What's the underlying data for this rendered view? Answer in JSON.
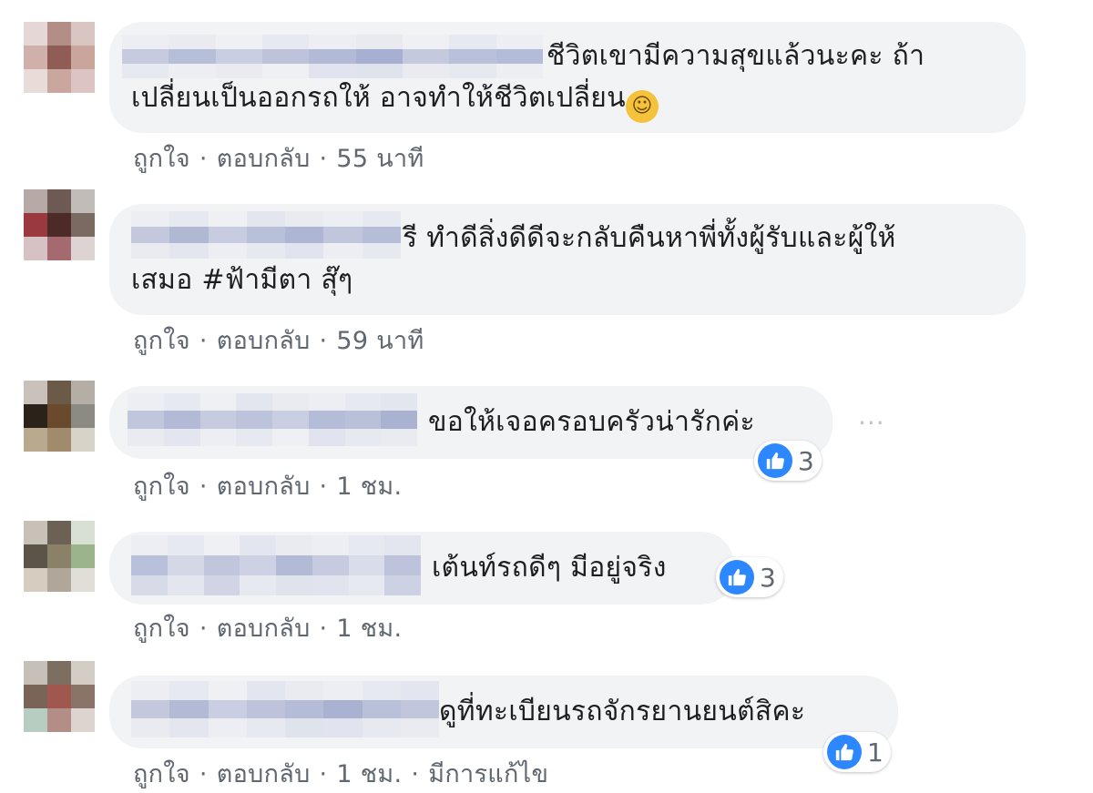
{
  "actions": {
    "like": "ถูกใจ",
    "reply": "ตอบกลับ",
    "separator": "·",
    "edited": "มีการแก้ไข"
  },
  "comments": [
    {
      "line1": "ชีวิตเขามีความสุขแล้วนะคะ ถ้า",
      "line2": "เปลี่ยนเป็นออกรถให้ อาจทำให้ชีวิตเปลี่ยน",
      "emoji": "grinning-face",
      "time": "55 นาที"
    },
    {
      "line1": "รี ทำดีสิ่งดีดีจะกลับคืนหาพี่ทั้งผู้รับและผู้ให้",
      "line2": "เสมอ #ฟ้ามีตา สุ๊ๆ",
      "time": "59 นาที"
    },
    {
      "line1": "ขอให้เจอครอบครัวน่ารักค่ะ",
      "reactions": "3",
      "time": "1 ชม.",
      "more_icon": "ellipsis-icon"
    },
    {
      "line1": "เต้นท์รถดีๆ มีอยู่จริง",
      "reactions": "3",
      "time": "1 ชม."
    },
    {
      "line1": "ดูที่ทะเบียนรถจักรยานยนต์สิคะ",
      "reactions": "1",
      "time": "1 ชม.",
      "edited": true
    }
  ],
  "colors": {
    "bubble": "#f2f3f5",
    "meta_text": "#606770",
    "like_blue": "#2d88ff"
  }
}
